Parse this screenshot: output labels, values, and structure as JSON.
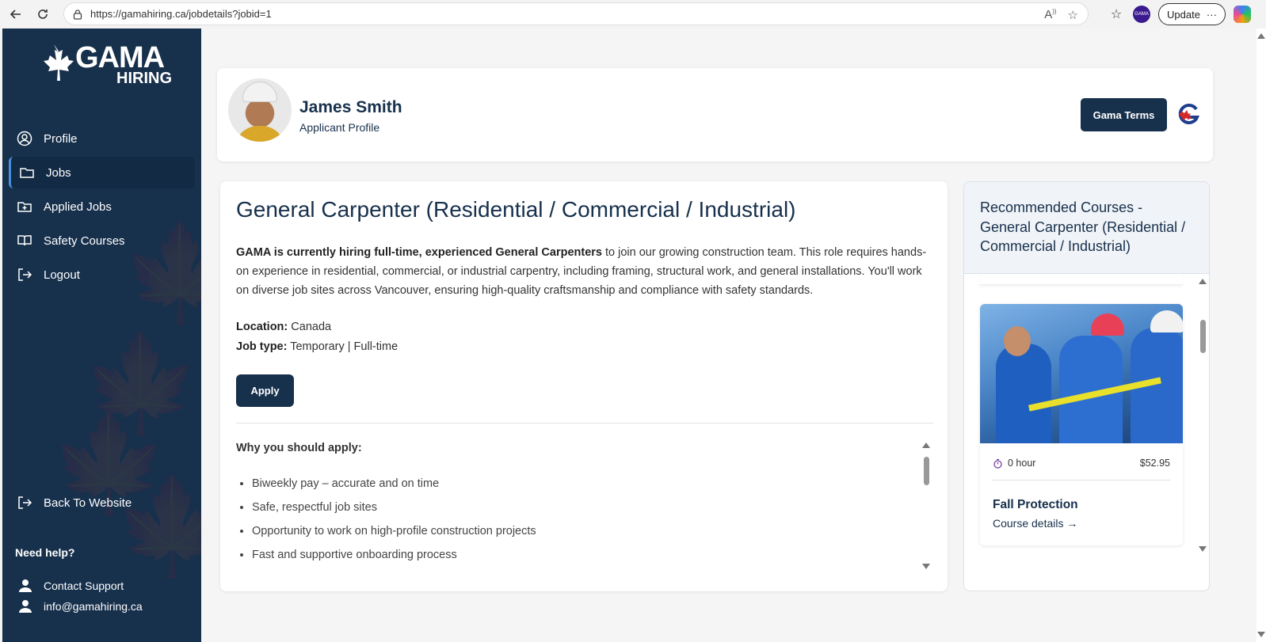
{
  "browser": {
    "url": "https://gamahiring.ca/jobdetails?jobid=1",
    "update_label": "Update",
    "profile_initials": "GAMA"
  },
  "sidebar": {
    "logo_top": "GAMA",
    "logo_bottom": "HIRING",
    "items": [
      {
        "label": "Profile"
      },
      {
        "label": "Jobs"
      },
      {
        "label": "Applied Jobs"
      },
      {
        "label": "Safety Courses"
      },
      {
        "label": "Logout"
      }
    ],
    "back_label": "Back To Website",
    "help_title": "Need help?",
    "contact_label": "Contact Support",
    "email": "info@gamahiring.ca"
  },
  "header": {
    "name": "James Smith",
    "role": "Applicant Profile",
    "terms_label": "Gama Terms"
  },
  "job": {
    "title": "General Carpenter (Residential / Commercial / Industrial)",
    "desc_bold": "GAMA is currently hiring full-time, experienced General Carpenters",
    "desc_rest": " to join our growing construction team. This role requires hands-on experience in residential, commercial, or industrial carpentry, including framing, structural work, and general installations. You'll work on diverse job sites across Vancouver, ensuring high-quality craftsmanship and compliance with safety standards.",
    "location_label": "Location:",
    "location": "Canada",
    "type_label": "Job type:",
    "type": "Temporary | Full-time",
    "apply_label": "Apply",
    "why_title": "Why you should apply:",
    "benefits": [
      "Biweekly pay – accurate and on time",
      "Safe, respectful job sites",
      "Opportunity to work on high-profile construction projects",
      "Fast and supportive onboarding process"
    ]
  },
  "courses": {
    "title": "Recommended Courses - General Carpenter (Residential / Commercial / Industrial)",
    "card": {
      "duration": "0 hour",
      "price": "$52.95",
      "name": "Fall Protection",
      "link": "Course details →"
    }
  },
  "colors": {
    "navy": "#17304c",
    "accent": "#4a90d9"
  }
}
